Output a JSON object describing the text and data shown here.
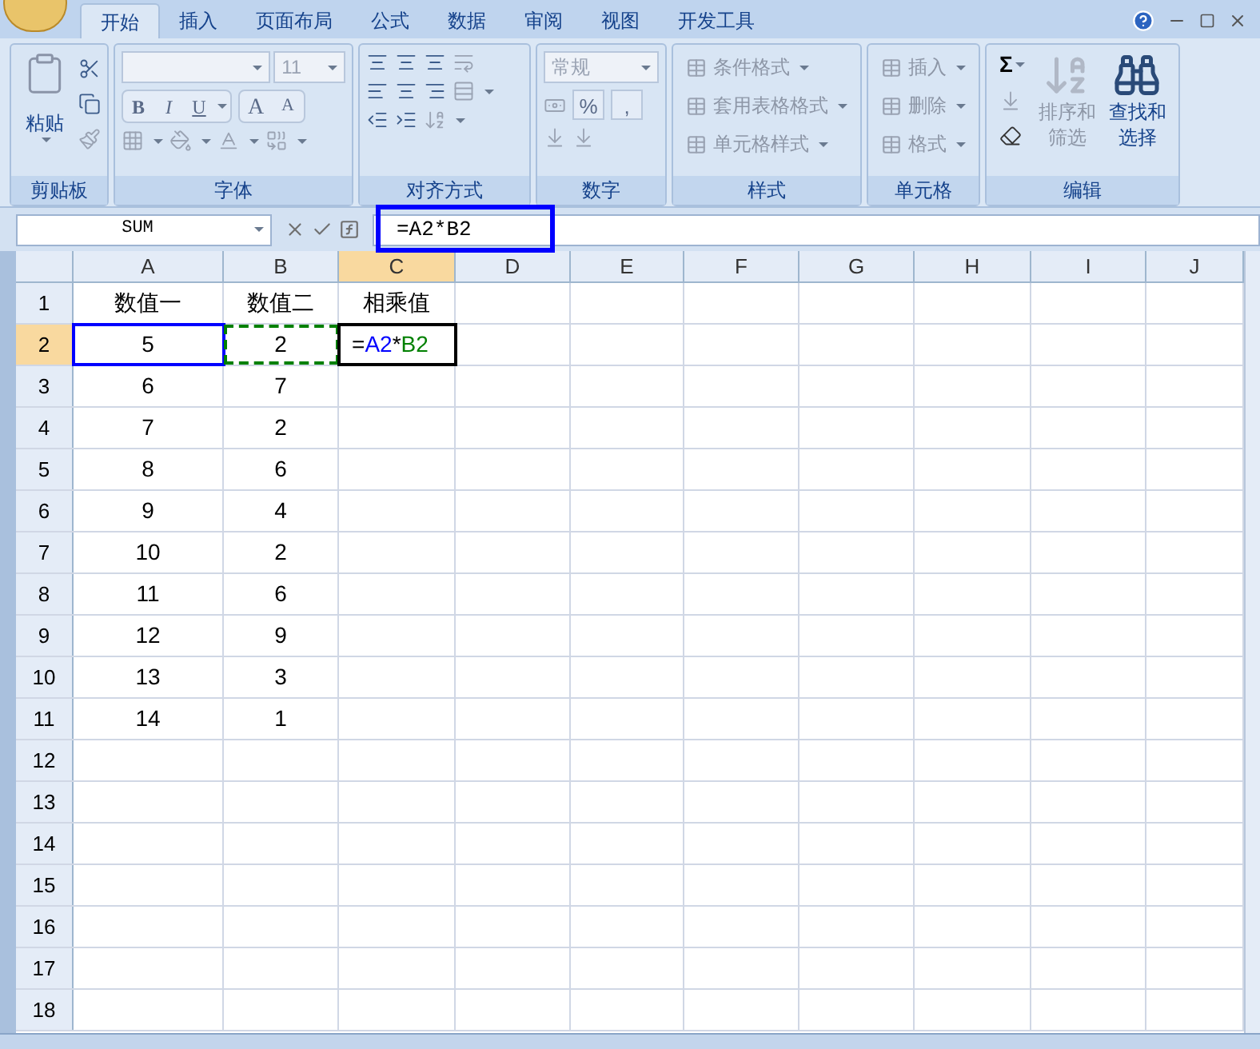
{
  "tabs": [
    {
      "label": "开始",
      "selected": true
    },
    {
      "label": "插入",
      "selected": false
    },
    {
      "label": "页面布局",
      "selected": false
    },
    {
      "label": "公式",
      "selected": false
    },
    {
      "label": "数据",
      "selected": false
    },
    {
      "label": "审阅",
      "selected": false
    },
    {
      "label": "视图",
      "selected": false
    },
    {
      "label": "开发工具",
      "selected": false
    }
  ],
  "ribbon": [
    {
      "kind": "clipboard",
      "label": "剪贴板",
      "paste": "粘贴"
    },
    {
      "kind": "font",
      "label": "字体",
      "font_size": "11",
      "style_buttons": [
        "B",
        "I",
        "U"
      ],
      "size_buttons": [
        "A",
        "A"
      ]
    },
    {
      "kind": "alignment",
      "label": "对齐方式"
    },
    {
      "kind": "number",
      "label": "数字",
      "format": "常规",
      "symbols": [
        "%",
        ","
      ]
    },
    {
      "kind": "menu_list",
      "label": "样式",
      "items": [
        {
          "label": "条件格式",
          "disabled": true
        },
        {
          "label": "套用表格格式",
          "disabled": true
        },
        {
          "label": "单元格样式",
          "disabled": true
        }
      ]
    },
    {
      "kind": "menu_list",
      "label": "单元格",
      "items": [
        {
          "label": "插入",
          "disabled": true
        },
        {
          "label": "删除",
          "disabled": true
        },
        {
          "label": "格式",
          "disabled": true
        }
      ]
    },
    {
      "kind": "editing",
      "label": "编辑",
      "sum": "Σ",
      "items": [
        {
          "line1": "排序和",
          "line2": "筛选",
          "disabled": true
        },
        {
          "line1": "查找和",
          "line2": "选择",
          "disabled": false
        }
      ]
    }
  ],
  "formula_bar": {
    "name_box": "SUM",
    "formula": "=A2*B2",
    "highlighted": true
  },
  "sheet": {
    "columns": [
      {
        "label": "A",
        "selected": false
      },
      {
        "label": "B",
        "selected": false
      },
      {
        "label": "C",
        "selected": true
      },
      {
        "label": "D",
        "selected": false
      },
      {
        "label": "E",
        "selected": false
      },
      {
        "label": "F",
        "selected": false
      },
      {
        "label": "G",
        "selected": false
      },
      {
        "label": "H",
        "selected": false
      },
      {
        "label": "I",
        "selected": false
      },
      {
        "label": "J",
        "selected": false
      }
    ],
    "rows": [
      {
        "label": "1",
        "selected": false,
        "cells": [
          "数值一",
          "数值二",
          "相乘值"
        ]
      },
      {
        "label": "2",
        "selected": true,
        "cells": [
          "5",
          "2"
        ],
        "editing": [
          {
            "text": "=",
            "color": "#000000"
          },
          {
            "text": "A2",
            "color": "#0000ff"
          },
          {
            "text": "*",
            "color": "#000000"
          },
          {
            "text": "B2",
            "color": "#008000"
          }
        ]
      },
      {
        "label": "3",
        "selected": false,
        "cells": [
          "6",
          "7"
        ]
      },
      {
        "label": "4",
        "selected": false,
        "cells": [
          "7",
          "2"
        ]
      },
      {
        "label": "5",
        "selected": false,
        "cells": [
          "8",
          "6"
        ]
      },
      {
        "label": "6",
        "selected": false,
        "cells": [
          "9",
          "4"
        ]
      },
      {
        "label": "7",
        "selected": false,
        "cells": [
          "10",
          "2"
        ]
      },
      {
        "label": "8",
        "selected": false,
        "cells": [
          "11",
          "6"
        ]
      },
      {
        "label": "9",
        "selected": false,
        "cells": [
          "12",
          "9"
        ]
      },
      {
        "label": "10",
        "selected": false,
        "cells": [
          "13",
          "3"
        ]
      },
      {
        "label": "11",
        "selected": false,
        "cells": [
          "14",
          "1"
        ]
      },
      {
        "label": "12",
        "selected": false,
        "cells": []
      },
      {
        "label": "13",
        "selected": false,
        "cells": []
      },
      {
        "label": "14",
        "selected": false,
        "cells": []
      },
      {
        "label": "15",
        "selected": false,
        "cells": []
      },
      {
        "label": "16",
        "selected": false,
        "cells": []
      },
      {
        "label": "17",
        "selected": false,
        "cells": []
      },
      {
        "label": "18",
        "selected": false,
        "cells": []
      }
    ]
  }
}
